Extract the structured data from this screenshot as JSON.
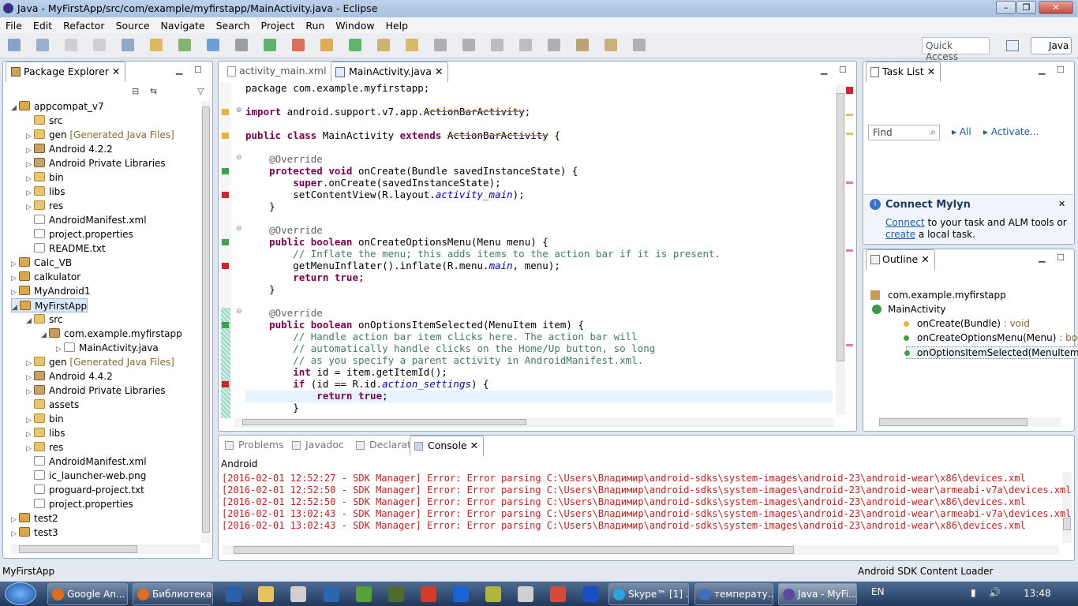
{
  "window": {
    "title": "Java - MyFirstApp/src/com/example/myfirstapp/MainActivity.java - Eclipse"
  },
  "menu": [
    "File",
    "Edit",
    "Refactor",
    "Source",
    "Navigate",
    "Search",
    "Project",
    "Run",
    "Window",
    "Help"
  ],
  "toolbar": {
    "quick_access": "Quick Access",
    "perspective": "Java"
  },
  "package_explorer": {
    "title": "Package Explorer",
    "rows": [
      {
        "t": "appcompat_v7",
        "lvl": 0,
        "exp": "open",
        "ic": "proj"
      },
      {
        "t": "src",
        "lvl": 1,
        "exp": "",
        "ic": "fold"
      },
      {
        "t": "gen",
        "lvl": 1,
        "exp": "closed",
        "ic": "fold",
        "extra": "[Generated Java Files]"
      },
      {
        "t": "Android 4.2.2",
        "lvl": 1,
        "exp": "closed",
        "ic": "jar"
      },
      {
        "t": "Android Private Libraries",
        "lvl": 1,
        "exp": "closed",
        "ic": "jar"
      },
      {
        "t": "bin",
        "lvl": 1,
        "exp": "closed",
        "ic": "fold"
      },
      {
        "t": "libs",
        "lvl": 1,
        "exp": "closed",
        "ic": "fold"
      },
      {
        "t": "res",
        "lvl": 1,
        "exp": "closed",
        "ic": "fold"
      },
      {
        "t": "AndroidManifest.xml",
        "lvl": 1,
        "exp": "",
        "ic": "file"
      },
      {
        "t": "project.properties",
        "lvl": 1,
        "exp": "",
        "ic": "file"
      },
      {
        "t": "README.txt",
        "lvl": 1,
        "exp": "",
        "ic": "file"
      },
      {
        "t": "Calc_VB",
        "lvl": 0,
        "exp": "closed",
        "ic": "proj"
      },
      {
        "t": "calkulator",
        "lvl": 0,
        "exp": "closed",
        "ic": "proj"
      },
      {
        "t": "MyAndroid1",
        "lvl": 0,
        "exp": "closed",
        "ic": "proj"
      },
      {
        "t": "MyFirstApp",
        "lvl": 0,
        "exp": "open",
        "ic": "proj",
        "sel": true
      },
      {
        "t": "src",
        "lvl": 1,
        "exp": "open",
        "ic": "fold"
      },
      {
        "t": "com.example.myfirstapp",
        "lvl": 2,
        "exp": "open",
        "ic": "pkg"
      },
      {
        "t": "MainActivity.java",
        "lvl": 3,
        "exp": "closed",
        "ic": "file"
      },
      {
        "t": "gen",
        "lvl": 1,
        "exp": "closed",
        "ic": "fold",
        "extra": "[Generated Java Files]"
      },
      {
        "t": "Android 4.4.2",
        "lvl": 1,
        "exp": "closed",
        "ic": "jar"
      },
      {
        "t": "Android Private Libraries",
        "lvl": 1,
        "exp": "closed",
        "ic": "jar"
      },
      {
        "t": "assets",
        "lvl": 1,
        "exp": "",
        "ic": "fold"
      },
      {
        "t": "bin",
        "lvl": 1,
        "exp": "closed",
        "ic": "fold"
      },
      {
        "t": "libs",
        "lvl": 1,
        "exp": "closed",
        "ic": "fold"
      },
      {
        "t": "res",
        "lvl": 1,
        "exp": "closed",
        "ic": "fold"
      },
      {
        "t": "AndroidManifest.xml",
        "lvl": 1,
        "exp": "",
        "ic": "file"
      },
      {
        "t": "ic_launcher-web.png",
        "lvl": 1,
        "exp": "",
        "ic": "file"
      },
      {
        "t": "proguard-project.txt",
        "lvl": 1,
        "exp": "",
        "ic": "file"
      },
      {
        "t": "project.properties",
        "lvl": 1,
        "exp": "",
        "ic": "file"
      },
      {
        "t": "test2",
        "lvl": 0,
        "exp": "closed",
        "ic": "proj"
      },
      {
        "t": "test3",
        "lvl": 0,
        "exp": "closed",
        "ic": "proj"
      }
    ]
  },
  "editor": {
    "tabs": [
      "activity_main.xml",
      "MainActivity.java"
    ],
    "lines": [
      [
        [
          "n",
          "package com.example.myfirstapp;"
        ]
      ],
      [],
      [
        [
          "k",
          "import"
        ],
        [
          "n",
          " android.support.v7.app."
        ],
        [
          "s",
          "ActionBarActivity"
        ],
        [
          "n",
          ";"
        ]
      ],
      [],
      [
        [
          "k",
          "public class"
        ],
        [
          "n",
          " MainActivity "
        ],
        [
          "k",
          "extends"
        ],
        [
          "n",
          " "
        ],
        [
          "s",
          "ActionBarActivity"
        ],
        [
          "n",
          " {"
        ]
      ],
      [],
      [
        [
          "a",
          "    @Override"
        ]
      ],
      [
        [
          "k",
          "    protected void"
        ],
        [
          "n",
          " onCreate(Bundle "
        ],
        [
          "n",
          "savedInstanceState"
        ],
        [
          "n",
          ") {"
        ]
      ],
      [
        [
          "k",
          "        super"
        ],
        [
          "n",
          ".onCreate("
        ],
        [
          "n",
          "savedInstanceState"
        ],
        [
          "n",
          ");"
        ]
      ],
      [
        [
          "n",
          "        setContentView(R.layout."
        ],
        [
          "p",
          "activity_main"
        ],
        [
          "n",
          ");"
        ]
      ],
      [
        [
          "n",
          "    }"
        ]
      ],
      [],
      [
        [
          "a",
          "    @Override"
        ]
      ],
      [
        [
          "k",
          "    public boolean"
        ],
        [
          "n",
          " onCreateOptionsMenu(Menu menu) {"
        ]
      ],
      [
        [
          "c",
          "        // Inflate the menu; this adds items to the action bar if it is present."
        ]
      ],
      [
        [
          "n",
          "        getMenuInflater().inflate(R.menu."
        ],
        [
          "p",
          "main"
        ],
        [
          "n",
          ", menu);"
        ]
      ],
      [
        [
          "k",
          "        return true"
        ],
        [
          "n",
          ";"
        ]
      ],
      [
        [
          "n",
          "    }"
        ]
      ],
      [],
      [
        [
          "a",
          "    @Override"
        ]
      ],
      [
        [
          "k",
          "    public boolean"
        ],
        [
          "n",
          " onOptionsItemSelected(MenuItem item) {"
        ]
      ],
      [
        [
          "c",
          "        // Handle action bar item clicks here. The action bar will"
        ]
      ],
      [
        [
          "c",
          "        // automatically handle clicks on the Home/Up button, so long"
        ]
      ],
      [
        [
          "c",
          "        // as you specify a parent activity in AndroidManifest.xml."
        ]
      ],
      [
        [
          "k",
          "        int"
        ],
        [
          "n",
          " id = item.getItemId();"
        ]
      ],
      [
        [
          "k",
          "        if"
        ],
        [
          "n",
          " (id == R.id."
        ],
        [
          "p",
          "action_settings"
        ],
        [
          "n",
          ") {"
        ]
      ],
      [
        [
          "k",
          "            return true"
        ],
        [
          "n",
          ";"
        ]
      ],
      [
        [
          "n",
          "        }"
        ]
      ]
    ]
  },
  "task_list": {
    "title": "Task List",
    "find": "Find",
    "all": "All",
    "activate": "Activate..."
  },
  "mylyn": {
    "title": "Connect Mylyn",
    "connect": "Connect",
    "text1": " to your task and ALM tools or",
    "create": "create",
    "text2": " a local task."
  },
  "outline": {
    "title": "Outline",
    "pkg": "com.example.myfirstapp",
    "cls": "MainActivity",
    "items": [
      {
        "n": "onCreate(Bundle)",
        "t": " : void"
      },
      {
        "n": "onCreateOptionsMenu(Menu)",
        "t": " : boo"
      },
      {
        "n": "onOptionsItemSelected(MenuItem)",
        "t": ""
      }
    ]
  },
  "bottom": {
    "tabs": [
      "Problems",
      "Javadoc",
      "Declaration",
      "Console"
    ],
    "console_name": "Android",
    "lines": [
      "[2016-02-01 12:52:27 - SDK Manager] Error: Error parsing C:\\Users\\Владимир\\android-sdks\\system-images\\android-23\\android-wear\\x86\\devices.xml",
      "[2016-02-01 12:52:50 - SDK Manager] Error: Error parsing C:\\Users\\Владимир\\android-sdks\\system-images\\android-23\\android-wear\\armeabi-v7a\\devices.xml",
      "[2016-02-01 12:52:50 - SDK Manager] Error: Error parsing C:\\Users\\Владимир\\android-sdks\\system-images\\android-23\\android-wear\\x86\\devices.xml",
      "[2016-02-01 13:02:43 - SDK Manager] Error: Error parsing C:\\Users\\Владимир\\android-sdks\\system-images\\android-23\\android-wear\\armeabi-v7a\\devices.xml",
      "[2016-02-01 13:02:43 - SDK Manager] Error: Error parsing C:\\Users\\Владимир\\android-sdks\\system-images\\android-23\\android-wear\\x86\\devices.xml"
    ]
  },
  "status": {
    "left": "MyFirstApp",
    "right": "Android SDK Content Loader"
  },
  "taskbar": {
    "items": [
      {
        "t": "Google An...",
        "c": "#e26b1c"
      },
      {
        "t": "Библиотека",
        "c": "#e26b1c"
      },
      {
        "t": "Skype™ [1] ...",
        "c": "#2aa4e3"
      },
      {
        "t": "температу...",
        "c": "#3b6fc4"
      },
      {
        "t": "Java - MyFi...",
        "c": "#5a4aa6"
      }
    ],
    "lang": "EN",
    "clock": "13:48"
  }
}
